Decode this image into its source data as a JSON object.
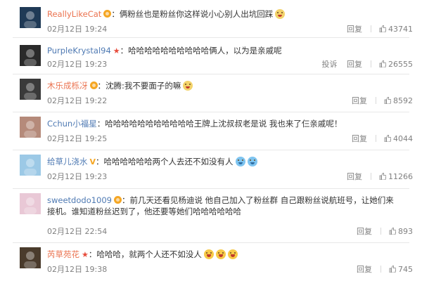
{
  "comments": [
    {
      "user": "ReallyLikeCat",
      "badge": "vip",
      "text": "俩粉丝也是粉丝你这样说小心别人出坑回踩",
      "emoji": [
        "cat"
      ],
      "time": "02月12日 19:24",
      "reply": "回复",
      "likes": "43741",
      "extra": ""
    },
    {
      "user": "PurpleKrystal94",
      "badge": "star",
      "text": "哈哈哈哈哈哈哈哈哈哈俩人，以为是亲戚呢",
      "emoji": [],
      "time": "02月12日 19:23",
      "reply": "回复",
      "likes": "26555",
      "extra": "投诉"
    },
    {
      "user": "木乐成栎冴",
      "badge": "vip",
      "text": "沈腾:我不要面子的嘛",
      "emoji": [
        "cat"
      ],
      "time": "02月12日 19:22",
      "reply": "回复",
      "likes": "8592",
      "extra": ""
    },
    {
      "user": "Cchun小福星",
      "badge": "none",
      "text": "哈哈哈哈哈哈哈哈哈哈哈王牌上沈叔叔老是说 我也来了仨亲戚呢！",
      "emoji": [],
      "time": "02月12日 19:25",
      "reply": "回复",
      "likes": "4044",
      "extra": ""
    },
    {
      "user": "给草儿浇水",
      "badge": "v",
      "text": "哈哈哈哈哈哈两个人去还不如没有人",
      "emoji": [
        "cry",
        "cry"
      ],
      "time": "02月12日 19:23",
      "reply": "回复",
      "likes": "11266",
      "extra": ""
    },
    {
      "user": "sweetdodo1009",
      "badge": "vip",
      "text": "前几天还看见杨迪说 他自己加入了粉丝群 自己跟粉丝说航班号，让她们来接机。谁知道粉丝迟到了，他还要等她们哈哈哈哈哈哈",
      "emoji": [],
      "time": "02月12日 22:54",
      "reply": "回复",
      "likes": "893",
      "extra": ""
    },
    {
      "user": "芮草苑花",
      "badge": "star",
      "text": "哈哈哈，就两个人还不如没人",
      "emoji": [
        "laugh",
        "laugh",
        "laugh"
      ],
      "time": "02月12日 19:38",
      "reply": "回复",
      "likes": "745",
      "extra": ""
    }
  ],
  "colors": {
    "username": "#eb7350",
    "username_alt": "#4f7ab3",
    "meta": "#808080",
    "text": "#333333"
  }
}
